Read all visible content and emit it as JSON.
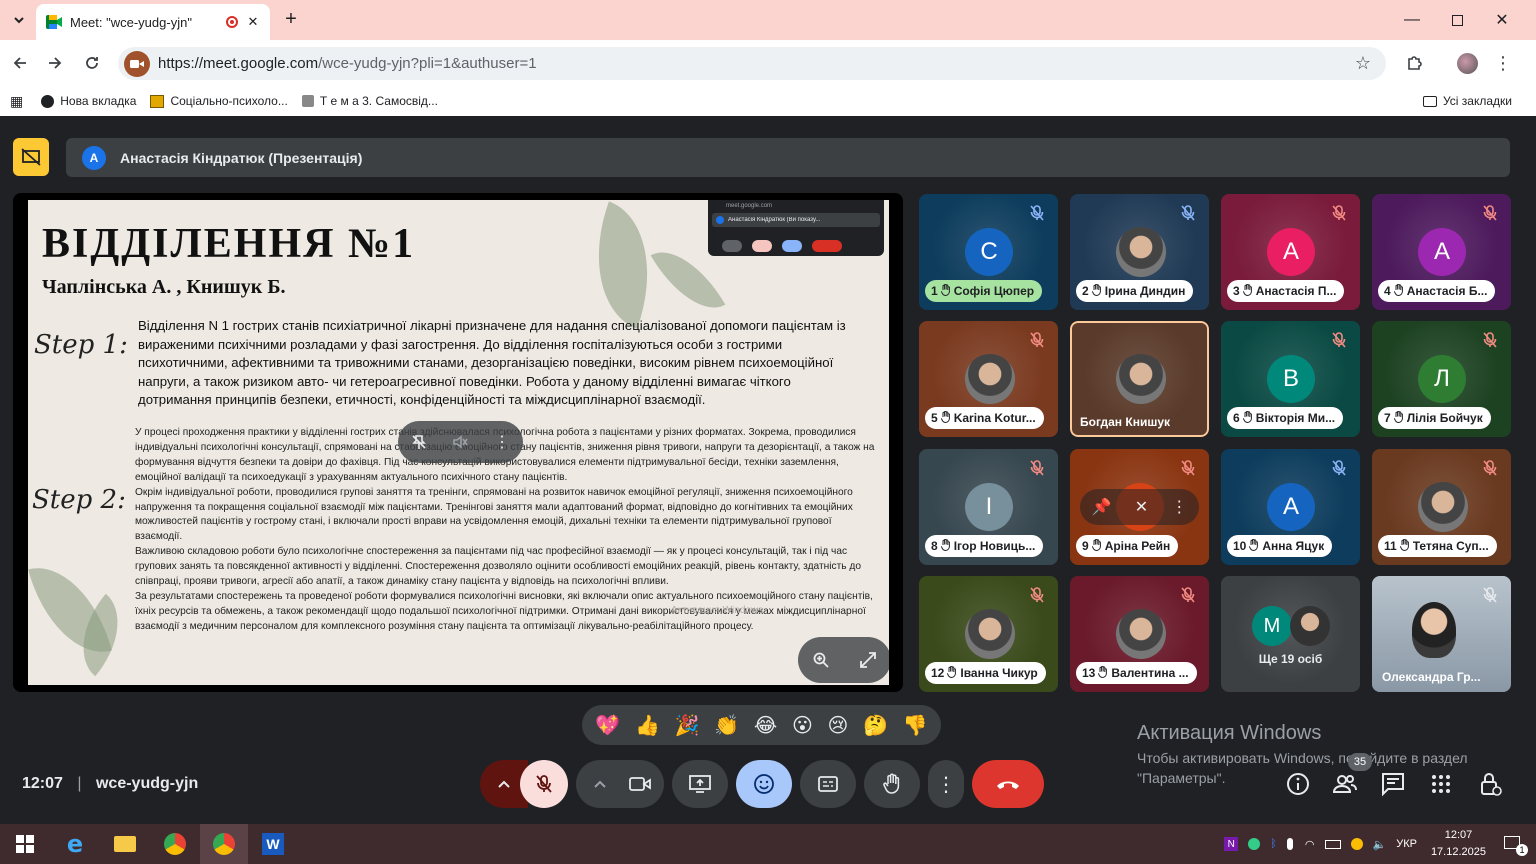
{
  "browser": {
    "tab_title": "Meet: \"wce-yudg-yjn\"",
    "url_host": "https://meet.google.com",
    "url_path": "/wce-yudg-yjn?pli=1&authuser=1",
    "bookmarks": [
      {
        "label": "Нова вкладка",
        "icon": "globe-icon"
      },
      {
        "label": "Соціально-психоло...",
        "icon": "folder-book-icon"
      },
      {
        "label": "Т е м а 3. Самосвід...",
        "icon": "doc-icon"
      }
    ],
    "all_bookmarks": "Усі закладки",
    "accent": "#fbd4cf"
  },
  "meet": {
    "presenter_initial": "A",
    "presenter_label": "Анастасія Кіндратюк (Презентація)",
    "slide": {
      "title": "ВІДДІЛЕННЯ №1",
      "authors": "Чаплінська А. , Книшук Б.",
      "step1": "Step 1:",
      "step2": "Step 2:",
      "para1": "Відділення N 1 гострих станів психіатричної лікарні призначене для надання спеціалізованої допомоги пацієнтам із вираженими психічними розладами у фазі загострення. До відділення госпіталізуються особи з гострими психотичними, афективними та тривожними станами, дезорганізацією поведінки, високим рівнем психоемоційної напруги, а також ризиком авто- чи гетероагресивної поведінки. Робота у даному відділенні вимагає чіткого дотримання принципів безпеки, етичності, конфіденційності та міждисциплінарної взаємодії.",
      "para2a": "У процесі проходження практики у відділенні гострих станів здійснювалася психологічна робота з пацієнтами у різних форматах. Зокрема, проводилися індивідуальні психологічні консультації, спрямовані на стабілізацію емоційного стану пацієнтів, зниження рівня тривоги, напруги та дезорієнтації, а також на формування відчуття безпеки та довіри до фахівця. Під час консультацій використовувалися елементи підтримувальної бесіди, техніки заземлення, емоційної валідації та психоедукації з урахуванням актуального психічного стану пацієнтів.",
      "para2b": "Окрім індивідуальної роботи, проводилися групові заняття та тренінги, спрямовані на розвиток навичок емоційної регуляції, зниження психоемоційного напруження та покращення соціальної взаємодії між пацієнтами. Тренінгові заняття мали адаптований формат, відповідно до когнітивних та емоційних можливостей пацієнтів у гострому стані, і включали прості вправи на усвідомлення емоцій, дихальні техніки та елементи підтримувальної групової взаємодії.",
      "para2c": "Важливою складовою роботи було психологічне спостереження за пацієнтами під час професійної взаємодії — як у процесі консультацій, так і під час групових занять та повсякденної активності у відділенні. Спостереження дозволяло оцінити особливості емоційних реакцій, рівень контакту, здатність до співпраці, прояви тривоги, агресії або апатії, а також динаміку стану пацієнта у відповідь на психологічні впливи.",
      "para2d": "За результатами спостережень та проведеної роботи формувалися психологічні висновки, які включали опис актуального психоемоційного стану пацієнтів, їхніх ресурсів та обмежень, а також рекомендації щодо подальшої психологічної підтримки. Отримані дані використовувалися у межах міждисциплінарної взаємодії з медичним персоналом для комплексного розуміння стану пацієнта та оптимізації лікувально-реабілітаційного процесу.",
      "watermark": "Активация Windows",
      "pip_url": "meet.google.com",
      "pip_label": "Анастасія Кіндратюк (Ви показу..."
    },
    "tiles": [
      {
        "num": "1",
        "name": "Софія Цюпер",
        "initial": "С",
        "avatar_color": "#1565c0",
        "bg": "#0d3c5c",
        "active": true
      },
      {
        "num": "2",
        "name": "Ірина Диндин",
        "photo": true,
        "bg": "#203a55"
      },
      {
        "num": "3",
        "name": "Анастасія П...",
        "initial": "A",
        "avatar_color": "#e91e63",
        "bg": "#7a1b3b"
      },
      {
        "num": "4",
        "name": "Анастасія Б...",
        "initial": "A",
        "avatar_color": "#9c27b0",
        "bg": "#4d1a5c"
      },
      {
        "num": "5",
        "name": "Karina Kotur...",
        "photo": true,
        "bg": "#7a3a20"
      },
      {
        "num": "",
        "name": "Богдан Книшук",
        "photo": true,
        "bg": "#5a3a2a",
        "self": true
      },
      {
        "num": "6",
        "name": "Вікторія Ми...",
        "initial": "B",
        "avatar_color": "#00897b",
        "bg": "#0b4a44"
      },
      {
        "num": "7",
        "name": "Лілія Бойчук",
        "initial": "Л",
        "avatar_color": "#2e7d32",
        "bg": "#1d4222"
      },
      {
        "num": "8",
        "name": "Ігор Новиць...",
        "initial": "I",
        "avatar_color": "#78909c",
        "bg": "#37474f"
      },
      {
        "num": "9",
        "name": "Аріна Рейн",
        "initial": "",
        "avatar_color": "#d84315",
        "bg": "#8a3512",
        "hover": true
      },
      {
        "num": "10",
        "name": "Анна Яцук",
        "initial": "A",
        "avatar_color": "#1565c0",
        "bg": "#0d3c5c"
      },
      {
        "num": "11",
        "name": "Тетяна Суп...",
        "photo": true,
        "bg": "#6a3a20"
      },
      {
        "num": "12",
        "name": "Іванна Чикур",
        "photo": true,
        "bg": "#3a4a1a"
      },
      {
        "num": "13",
        "name": "Валентина ...",
        "photo": true,
        "bg": "#6a1a2a"
      },
      {
        "num": "",
        "name": "Ще 19 осіб",
        "initial": "M",
        "avatar_color": "#00897b",
        "bg": "#3c4043",
        "more": true
      },
      {
        "num": "",
        "name": "Олександра Гр...",
        "photo": true,
        "bg": "#5a6a7a",
        "video": true
      }
    ],
    "reactions": [
      "💖",
      "👍",
      "🎉",
      "👏",
      "😂",
      "😮",
      "😢",
      "🤔",
      "👎"
    ],
    "time": "12:07",
    "meeting_code": "wce-yudg-yjn",
    "participant_count": "35",
    "activation_title": "Активация Windows",
    "activation_text": "Чтобы активировать Windows, перейдите в раздел \"Параметры\"."
  },
  "taskbar": {
    "lang": "УКР",
    "time": "12:07",
    "date": "17.12.2025",
    "notif_count": "1"
  }
}
